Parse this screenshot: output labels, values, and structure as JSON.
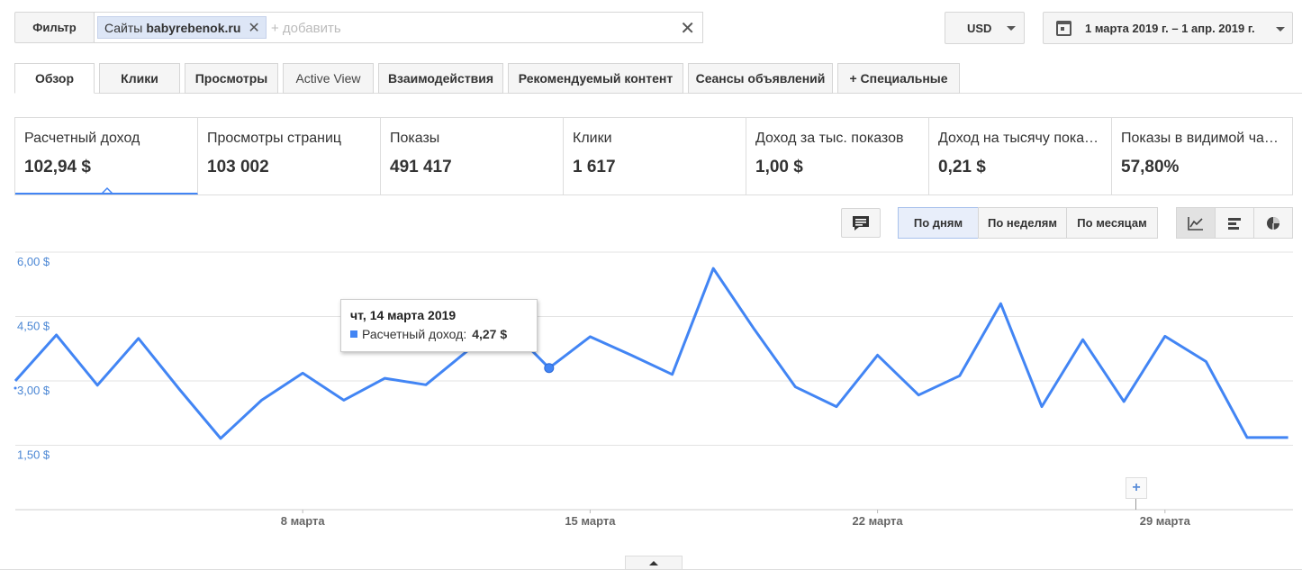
{
  "filter": {
    "button_label": "Фильтр",
    "chip_prefix": "Сайты",
    "chip_value": "babyrebenok.ru",
    "add_placeholder": "+ добавить"
  },
  "currency": "USD",
  "date_range": "1 марта 2019 г. – 1 апр. 2019 г.",
  "tabs": [
    {
      "label": "Обзор"
    },
    {
      "label": "Клики"
    },
    {
      "label": "Просмотры"
    },
    {
      "label": "Active View"
    },
    {
      "label": "Взаимодействия"
    },
    {
      "label": "Рекомендуемый контент"
    },
    {
      "label": "Сеансы объявлений"
    },
    {
      "label": "+ Специальные"
    }
  ],
  "metrics": [
    {
      "label": "Расчетный доход",
      "value": "102,94 $"
    },
    {
      "label": "Просмотры страниц",
      "value": "103 002"
    },
    {
      "label": "Показы",
      "value": "491 417"
    },
    {
      "label": "Клики",
      "value": "1 617"
    },
    {
      "label": "Доход за тыс. показов",
      "value": "1,00 $"
    },
    {
      "label": "Доход на тысячу показов",
      "value": "0,21 $"
    },
    {
      "label": "Показы в видимой части",
      "value": "57,80%"
    }
  ],
  "granularity": {
    "daily": "По дням",
    "weekly": "По неделям",
    "monthly": "По месяцам"
  },
  "tooltip": {
    "date": "чт, 14 марта 2019",
    "series": "Расчетный доход:",
    "value": "4,27 $"
  },
  "colors": {
    "line": "#4285f4",
    "axis_label": "#4a86d4"
  },
  "chart_data": {
    "type": "line",
    "y_ticks": [
      "6,00 $",
      "4,50 $",
      "3,00 $",
      "1,50 $"
    ],
    "ylim": [
      0,
      6
    ],
    "x_tick_labels": [
      "8 марта",
      "15 марта",
      "22 марта",
      "29 марта"
    ],
    "x_tick_days": [
      8,
      15,
      22,
      29
    ],
    "series": [
      {
        "x": [
          1,
          2,
          3,
          4,
          5,
          6,
          7,
          8,
          9,
          10,
          11,
          12,
          13,
          14,
          15,
          16,
          17,
          18,
          19,
          20,
          21,
          22,
          23,
          24,
          25,
          26,
          27,
          28,
          29,
          30,
          31,
          32
        ],
        "values": [
          3.0,
          4.07,
          2.9,
          3.99,
          2.8,
          1.66,
          2.55,
          3.18,
          2.55,
          3.06,
          2.91,
          3.69,
          4.27,
          3.3,
          4.03,
          3.6,
          3.15,
          5.62,
          4.2,
          2.86,
          2.4,
          3.6,
          2.67,
          3.12,
          4.8,
          2.4,
          3.96,
          2.52,
          4.04,
          3.45,
          1.68,
          1.68
        ]
      }
    ]
  }
}
